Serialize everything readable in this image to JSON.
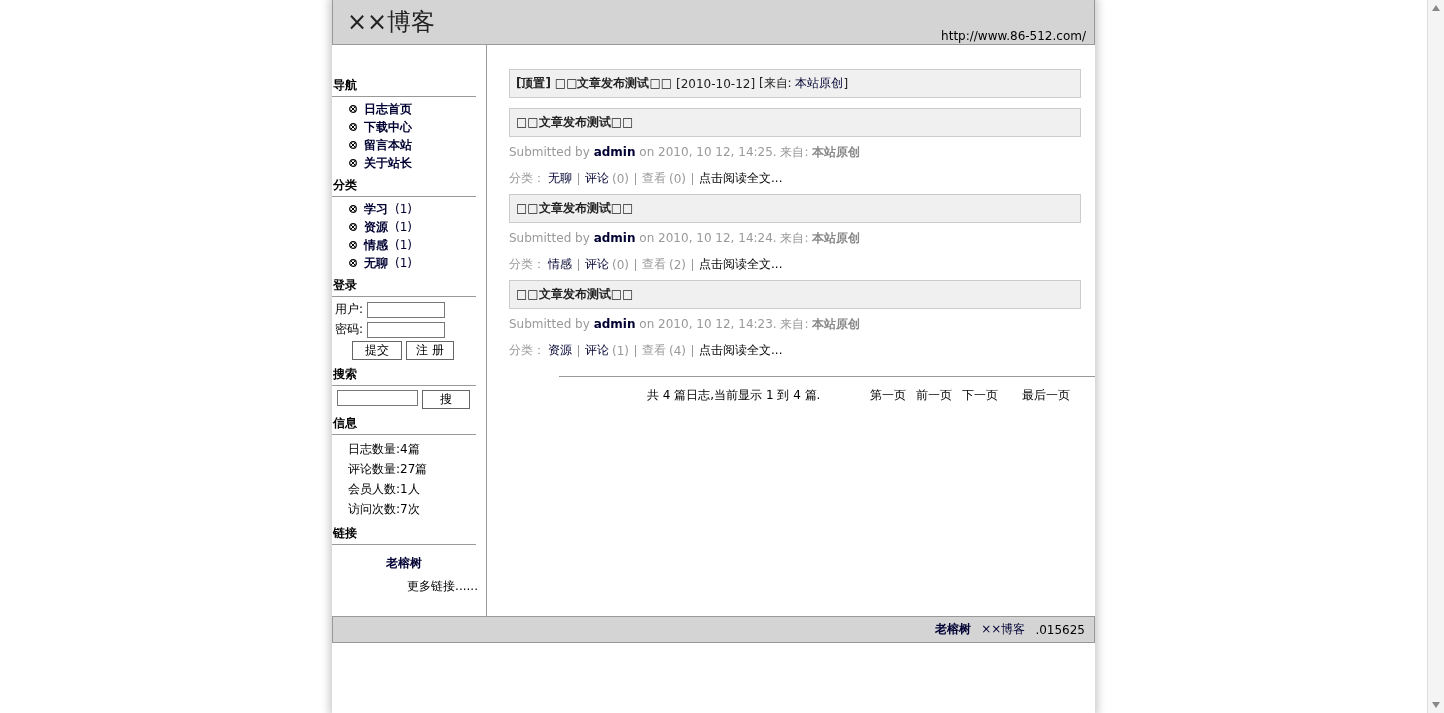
{
  "header": {
    "title": "××博客",
    "url": "http://www.86-512.com/"
  },
  "sidebar": {
    "sections": [
      {
        "kind": "nav",
        "heading": "导航",
        "items": [
          {
            "label": "日志首页"
          },
          {
            "label": "下载中心"
          },
          {
            "label": "留言本站"
          },
          {
            "label": "关于站长"
          }
        ]
      },
      {
        "kind": "nav",
        "heading": "分类",
        "items": [
          {
            "label": "学习",
            "count": "(1)"
          },
          {
            "label": "资源",
            "count": "(1)"
          },
          {
            "label": "情感",
            "count": "(1)"
          },
          {
            "label": "无聊",
            "count": "(1)"
          }
        ]
      },
      {
        "kind": "login",
        "heading": "登录",
        "fields": [
          {
            "label": "用户:"
          },
          {
            "label": "密码:"
          }
        ],
        "buttons": [
          "提交",
          "注 册"
        ]
      },
      {
        "kind": "search",
        "heading": "搜索",
        "button": "搜"
      },
      {
        "kind": "info",
        "heading": "信息",
        "lines": [
          "日志数量:4篇",
          "评论数量:27篇",
          "会员人数:1人",
          "访问次数:7次"
        ]
      },
      {
        "kind": "links",
        "heading": "链接",
        "link": "老榕树",
        "more": "更多链接......"
      }
    ]
  },
  "sticky": {
    "tag": "[顶置]",
    "title": "□□文章发布测试□□",
    "date": "[2010-10-12]",
    "source_label": "[来自:",
    "source": "本站原创",
    "close": "]"
  },
  "posts": [
    {
      "title": "□□文章发布测试□□",
      "submitted": "Submitted by",
      "author": "admin",
      "meta": "on 2010, 10 12, 14:25. 来自:",
      "source": "本站原创",
      "category_label": "分类：",
      "category": "无聊",
      "comments_label": "评论",
      "comments": "(0)",
      "views_label": "查看",
      "views": "(0)",
      "read_more": "点击阅读全文..."
    },
    {
      "title": "□□文章发布测试□□",
      "submitted": "Submitted by",
      "author": "admin",
      "meta": "on 2010, 10 12, 14:24. 来自:",
      "source": "本站原创",
      "category_label": "分类：",
      "category": "情感",
      "comments_label": "评论",
      "comments": "(0)",
      "views_label": "查看",
      "views": "(2)",
      "read_more": "点击阅读全文..."
    },
    {
      "title": "□□文章发布测试□□",
      "submitted": "Submitted by",
      "author": "admin",
      "meta": "on 2010, 10 12, 14:23. 来自:",
      "source": "本站原创",
      "category_label": "分类：",
      "category": "资源",
      "comments_label": "评论",
      "comments": "(1)",
      "views_label": "查看",
      "views": "(4)",
      "read_more": "点击阅读全文..."
    }
  ],
  "pagination": {
    "summary": "共 4 篇日志,当前显示 1 到 4 篇.",
    "links": [
      "第一页",
      "前一页",
      "下一页",
      "最后一页"
    ]
  },
  "footer": {
    "author": "老榕树",
    "site": "××博客",
    "time": ".015625"
  }
}
